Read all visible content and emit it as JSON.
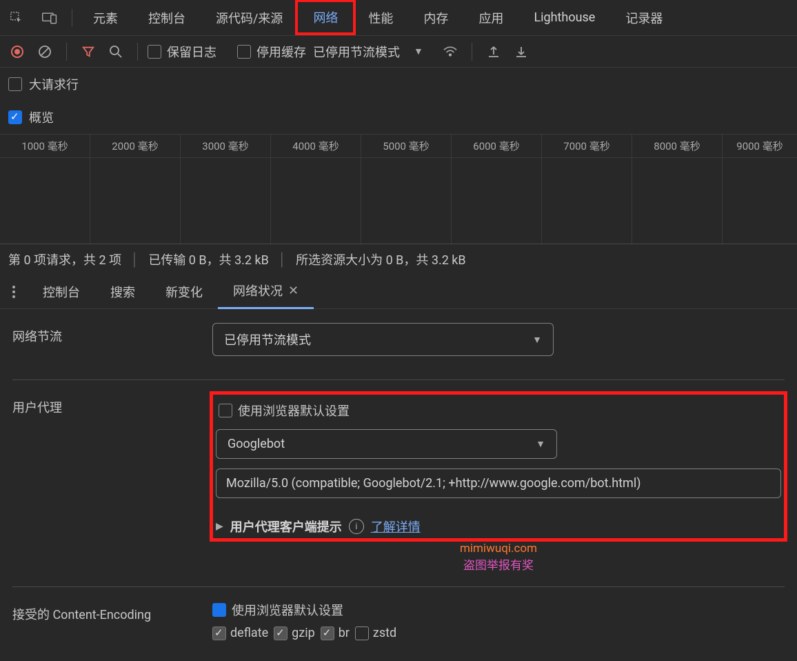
{
  "topTabs": [
    "元素",
    "控制台",
    "源代码/来源",
    "网络",
    "性能",
    "内存",
    "应用",
    "Lighthouse",
    "记录器"
  ],
  "activeTopTab": "网络",
  "toolbar": {
    "preserveLog": "保留日志",
    "disableCache": "停用缓存",
    "throttleLabel": "已停用节流模式"
  },
  "options": {
    "bigRequestRows": "大请求行",
    "overview": "概览"
  },
  "timeline": [
    "1000 毫秒",
    "2000 毫秒",
    "3000 毫秒",
    "4000 毫秒",
    "5000 毫秒",
    "6000 毫秒",
    "7000 毫秒",
    "8000 毫秒",
    "9000 毫秒"
  ],
  "statusBar": {
    "requests": "第 0 项请求，共 2 项",
    "transferred": "已传输 0 B，共 3.2 kB",
    "selected": "所选资源大小为 0 B，共 3.2 kB"
  },
  "drawerTabs": [
    "控制台",
    "搜索",
    "新变化",
    "网络状况"
  ],
  "activeDrawerTab": "网络状况",
  "networkConditions": {
    "throttleLabel": "网络节流",
    "throttleValue": "已停用节流模式",
    "uaLabel": "用户代理",
    "useBrowserDefault": "使用浏览器默认设置",
    "uaPreset": "Googlebot",
    "uaString": "Mozilla/5.0 (compatible; Googlebot/2.1; +http://www.google.com/bot.html)",
    "clientHints": "用户代理客户端提示",
    "learnMore": "了解详情"
  },
  "watermark": {
    "line1": "mimiwuqi.com",
    "line2": "盗图举报有奖"
  },
  "contentEncoding": {
    "label": "接受的 Content-Encoding",
    "useDefault": "使用浏览器默认设置",
    "opts": [
      "deflate",
      "gzip",
      "br",
      "zstd"
    ]
  }
}
